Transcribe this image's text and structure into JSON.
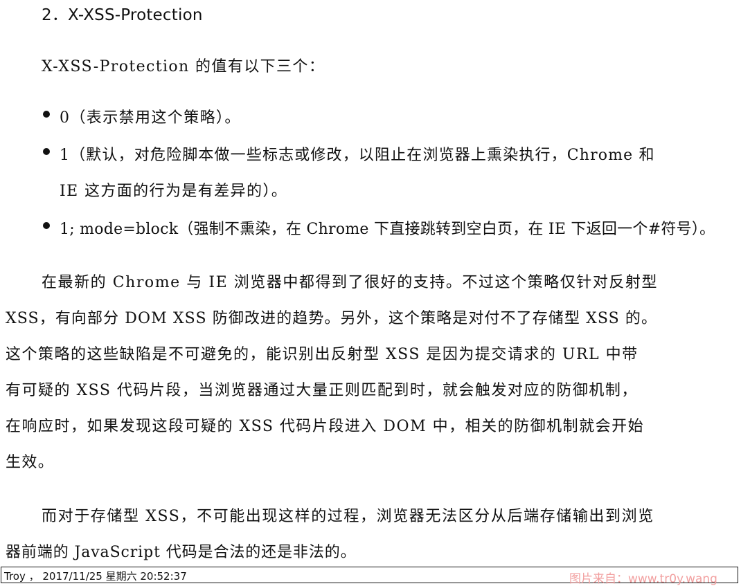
{
  "section": {
    "heading": "2．X-XSS-Protection"
  },
  "intro": "X-XSS-Protection 的值有以下三个：",
  "bullets": {
    "b1": "0（表示禁用这个策略）。",
    "b2_line1": "1（默认，对危险脚本做一些标志或修改，以阻止在浏览器上熏染执行，Chrome 和",
    "b2_line2": "IE 这方面的行为是有差异的）。",
    "b3": "1; mode=block（强制不熏染，在 Chrome 下直接跳转到空白页，在 IE 下返回一个#符号）。"
  },
  "paragraph1": [
    "在最新的 Chrome 与 IE 浏览器中都得到了很好的支持。不过这个策略仅针对反射型",
    "XSS，有向部分 DOM XSS 防御改进的趋势。另外，这个策略是对付不了存储型 XSS 的。",
    "这个策略的这些缺陷是不可避免的，能识别出反射型 XSS 是因为提交请求的 URL 中带",
    "有可疑的 XSS 代码片段，当浏览器通过大量正则匹配到时，就会触发对应的防御机制，",
    "在响应时，如果发现这段可疑的 XSS 代码片段进入 DOM 中，相关的防御机制就会开始",
    "生效。"
  ],
  "paragraph2": [
    "而对于存储型 XSS，不可能出现这样的过程，浏览器无法区分从后端存储输出到浏览",
    "器前端的 JavaScript 代码是合法的还是非法的。"
  ],
  "footer": {
    "stamp": "Troy ， 2017/11/25 星期六 20:52:37",
    "watermark": "图片来自：www.tr0y.wang"
  }
}
